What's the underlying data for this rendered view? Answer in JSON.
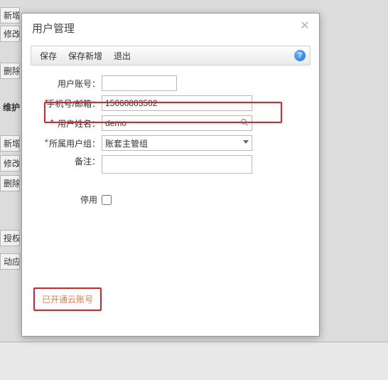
{
  "background": {
    "btn_add": "新增",
    "btn_edit": "修改",
    "btn_del": "删除",
    "label_maintain": "维护",
    "s_add": "新增",
    "s_edit": "修改",
    "s_del": "删除",
    "s_auth": "授权",
    "s_dyn": "动应"
  },
  "dialog": {
    "title": "用户管理",
    "close": "✕",
    "toolbar": {
      "save": "保存",
      "save_new": "保存新增",
      "exit": "退出",
      "help": "?"
    },
    "form": {
      "account_label": "用户账号：",
      "account_value": "",
      "phone_label": "手机号/邮箱：",
      "phone_value": "15060803502",
      "username_label": "用户姓名：",
      "username_value": "demo",
      "group_label": "所属用户组：",
      "group_value": "账套主管组",
      "remark_label": "备注：",
      "remark_value": "",
      "disable_label": "停用"
    },
    "cloud_badge": "已开通云账号"
  }
}
